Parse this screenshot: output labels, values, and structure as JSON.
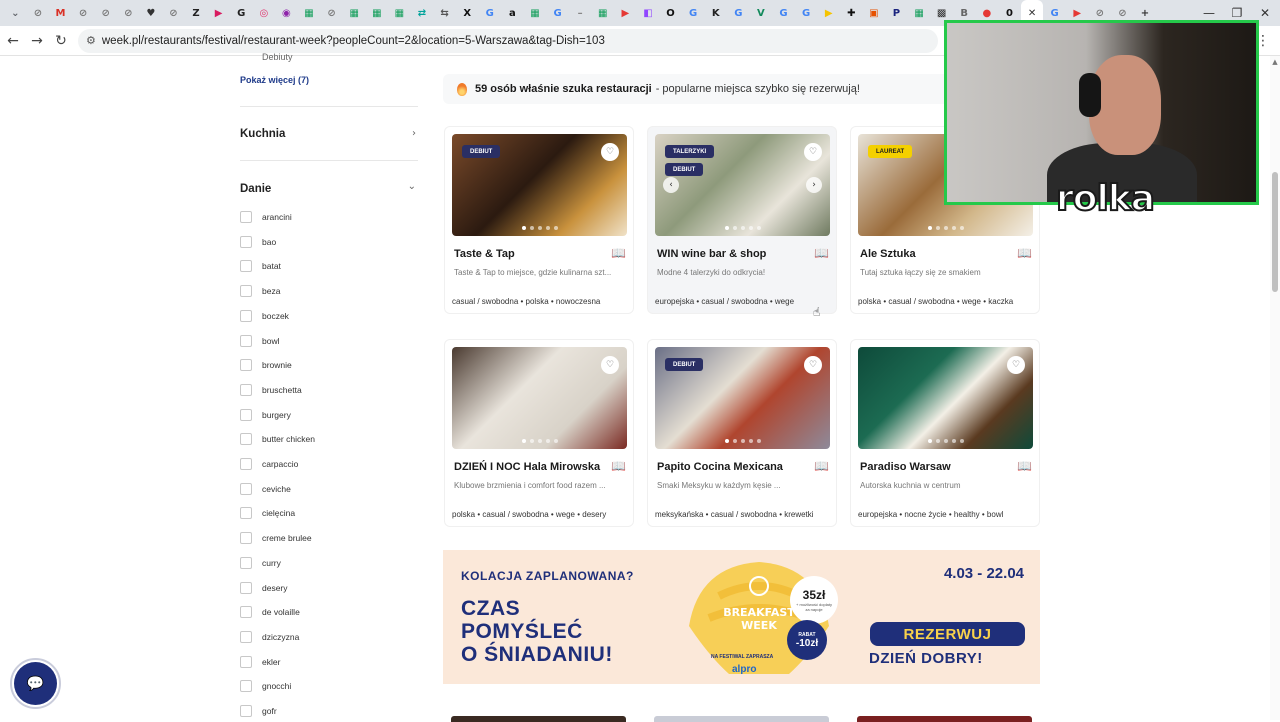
{
  "browser": {
    "tabs": [
      {
        "icon": "dropdown-icon",
        "color": "#5f6368",
        "glyph": "⌄"
      },
      {
        "icon": "site-icon",
        "color": "#7a7a7a",
        "glyph": "⊘"
      },
      {
        "icon": "gmail-icon",
        "color": "#d93025",
        "glyph": "M"
      },
      {
        "icon": "site-icon",
        "color": "#7a7a7a",
        "glyph": "⊘"
      },
      {
        "icon": "site-icon",
        "color": "#7a7a7a",
        "glyph": "⊘"
      },
      {
        "icon": "site-icon",
        "color": "#7a7a7a",
        "glyph": "⊘"
      },
      {
        "icon": "heart-tab-icon",
        "color": "#333333",
        "glyph": "♥"
      },
      {
        "icon": "site-icon",
        "color": "#7a7a7a",
        "glyph": "⊘"
      },
      {
        "icon": "z-icon",
        "color": "#222222",
        "glyph": "Z"
      },
      {
        "icon": "play-icon",
        "color": "#d81b60",
        "glyph": "▶"
      },
      {
        "icon": "g-icon",
        "color": "#222222",
        "glyph": "G"
      },
      {
        "icon": "instagram-icon",
        "color": "#e1306c",
        "glyph": "◎"
      },
      {
        "icon": "chat-tab-icon",
        "color": "#8e24aa",
        "glyph": "◉"
      },
      {
        "icon": "sheets-icon",
        "color": "#0f9d58",
        "glyph": "▦"
      },
      {
        "icon": "site-icon",
        "color": "#7a7a7a",
        "glyph": "⊘"
      },
      {
        "icon": "sheets-icon",
        "color": "#0f9d58",
        "glyph": "▦"
      },
      {
        "icon": "sheets-icon",
        "color": "#0f9d58",
        "glyph": "▦"
      },
      {
        "icon": "sheets-icon",
        "color": "#0f9d58",
        "glyph": "▦"
      },
      {
        "icon": "swap-icon",
        "color": "#00a39a",
        "glyph": "⇄"
      },
      {
        "icon": "swap-icon",
        "color": "#555555",
        "glyph": "⇆"
      },
      {
        "icon": "x-icon",
        "color": "#111111",
        "glyph": "X"
      },
      {
        "icon": "google-icon",
        "color": "#4285f4",
        "glyph": "G"
      },
      {
        "icon": "amazon-icon",
        "color": "#111111",
        "glyph": "a"
      },
      {
        "icon": "sheets-icon",
        "color": "#0f9d58",
        "glyph": "▦"
      },
      {
        "icon": "google-icon",
        "color": "#4285f4",
        "glyph": "G"
      },
      {
        "icon": "dash-icon",
        "color": "#888888",
        "glyph": "–"
      },
      {
        "icon": "sheets-icon",
        "color": "#0f9d58",
        "glyph": "▦"
      },
      {
        "icon": "youtube-icon",
        "color": "#e53935",
        "glyph": "▶"
      },
      {
        "icon": "twitch-icon",
        "color": "#9146ff",
        "glyph": "◧"
      },
      {
        "icon": "o-icon",
        "color": "#111111",
        "glyph": "O"
      },
      {
        "icon": "google-icon",
        "color": "#4285f4",
        "glyph": "G"
      },
      {
        "icon": "k-icon",
        "color": "#222222",
        "glyph": "K"
      },
      {
        "icon": "google-icon",
        "color": "#4285f4",
        "glyph": "G"
      },
      {
        "icon": "v-icon",
        "color": "#138a5c",
        "glyph": "V"
      },
      {
        "icon": "google-icon",
        "color": "#4285f4",
        "glyph": "G"
      },
      {
        "icon": "google-icon",
        "color": "#4285f4",
        "glyph": "G"
      },
      {
        "icon": "play-icon",
        "color": "#f5c400",
        "glyph": "▶"
      },
      {
        "icon": "plus-icon",
        "color": "#111111",
        "glyph": "✚"
      },
      {
        "icon": "image-icon",
        "color": "#e65100",
        "glyph": "▣"
      },
      {
        "icon": "p-icon",
        "color": "#1a237e",
        "glyph": "P"
      },
      {
        "icon": "sheets-icon",
        "color": "#0f9d58",
        "glyph": "▦"
      },
      {
        "icon": "grid-icon",
        "color": "#333333",
        "glyph": "▩"
      },
      {
        "icon": "b-icon",
        "color": "#666666",
        "glyph": "B"
      },
      {
        "icon": "pin-icon",
        "color": "#e53935",
        "glyph": "●"
      },
      {
        "icon": "zero-icon",
        "color": "#111111",
        "glyph": "0"
      },
      {
        "icon": "close-icon",
        "color": "#333333",
        "glyph": "✕",
        "active": true
      },
      {
        "icon": "google-icon",
        "color": "#4285f4",
        "glyph": "G"
      },
      {
        "icon": "youtube-icon",
        "color": "#e53935",
        "glyph": "▶"
      },
      {
        "icon": "site-icon",
        "color": "#7a7a7a",
        "glyph": "⊘"
      },
      {
        "icon": "site-icon",
        "color": "#7a7a7a",
        "glyph": "⊘"
      },
      {
        "icon": "new-tab-icon",
        "color": "#333333",
        "glyph": "+"
      }
    ],
    "url": "week.pl/restaurants/festival/restaurant-week?peopleCount=2&location=5-Warszawa&tag-Dish=103",
    "back_glyph": "←",
    "forward_glyph": "→",
    "reload_glyph": "↻",
    "tune_glyph": "⚙",
    "minimize_glyph": "—",
    "maximize_glyph": "❐",
    "close_glyph": "✕",
    "menu_glyph": "⋮"
  },
  "sidebar": {
    "top_text": "Debiuty",
    "show_more": "Pokaż więcej (7)",
    "sections": [
      {
        "label": "Kuchnia",
        "chevron": "›"
      },
      {
        "label": "Danie",
        "chevron": "⌄"
      }
    ],
    "dishes": [
      "arancini",
      "bao",
      "batat",
      "beza",
      "boczek",
      "bowl",
      "brownie",
      "bruschetta",
      "burgery",
      "butter chicken",
      "carpaccio",
      "ceviche",
      "cielęcina",
      "creme brulee",
      "curry",
      "desery",
      "de volaille",
      "dziczyzna",
      "ekler",
      "gnocchi",
      "gofr"
    ]
  },
  "notice": {
    "bold": "59 osób właśnie szuka restauracji",
    "rest": "- popularne miejsca szybko się rezerwują!"
  },
  "cards": [
    {
      "title": "Taste & Tap",
      "desc": "Taste & Tap to miejsce, gdzie kulinarna szt...",
      "tags": "casual / swobodna • polska • nowoczesna",
      "badges": [
        "DEBIUT"
      ],
      "photo": "linear-gradient(135deg,#7a4a2a 0%,#2b1a10 45%,#c9923d 75%,#f0e2c8 100%)"
    },
    {
      "title": "WIN wine bar & shop",
      "desc": "Modne 4 talerzyki do odkrycia!",
      "tags": "europejska • casual / swobodna • wege",
      "badges": [
        "TALERZYKI",
        "DEBIUT"
      ],
      "photo": "linear-gradient(135deg,#d9d2c4 0%,#8e9a7b 40%,#e8e4da 70%,#6f7a60 100%)"
    },
    {
      "title": "Ale Sztuka",
      "desc": "Tutaj sztuka łączy się ze smakiem",
      "tags": "polska • casual / swobodna • wege • kaczka",
      "badges": [
        "LAUREAT"
      ],
      "photo": "linear-gradient(135deg,#e8e3d8 0%,#9a6b3a 45%,#d2b78a 70%,#f4f0e8 100%)"
    },
    {
      "title": "DZIEŃ I NOC Hala Mirowska",
      "desc": "Klubowe brzmienia i comfort food razem ...",
      "tags": "polska • casual / swobodna • wege • desery",
      "badges": [],
      "photo": "linear-gradient(135deg,#4a3a30 0%,#e9e4dc 40%,#d8d2c8 70%,#7a2a22 100%)"
    },
    {
      "title": "Papito Cocina Mexicana",
      "desc": "Smaki Meksyku w każdym kęsie ...",
      "tags": "meksykańska • casual / swobodna • krewetki",
      "badges": [
        "DEBIUT"
      ],
      "photo": "linear-gradient(135deg,#6a6f86 0%,#e4ded2 40%,#b0452e 60%,#8e8a9a 100%)"
    },
    {
      "title": "Paradiso Warsaw",
      "desc": "Autorska kuchnia w centrum",
      "tags": "europejska • nocne życie • healthy • bowl",
      "badges": [],
      "photo": "linear-gradient(135deg,#0e4a3a 0%,#1c6b52 35%,#f3efe6 55%,#5a3a20 75%,#0e4a3a 100%)"
    }
  ],
  "banner": {
    "question": "KOLACJA ZAPLANOWANA?",
    "headline_1": "CZAS",
    "headline_2": "POMYŚLEĆ",
    "headline_3": "O ŚNIADANIU!",
    "dates": "4.03 - 22.04",
    "croissant_text_1": "BREAKFAST",
    "croissant_text_2": "WEEK",
    "price": "35zł",
    "price_note": "+ możliwość dopłaty za napoje",
    "rabat_label": "RABAT",
    "rabat_value": "-10zł",
    "festival": "NA FESTIWAL ZAPRASZA",
    "brand": "alpro",
    "button": "REZERWUJ",
    "sub": "DZIEŃ DOBRY!"
  },
  "overlay": {
    "label": "rolka"
  },
  "icons": {
    "heart": "♡",
    "book": "📖",
    "prev": "‹",
    "next": "›",
    "chat": "💬",
    "cursor": "☝"
  }
}
